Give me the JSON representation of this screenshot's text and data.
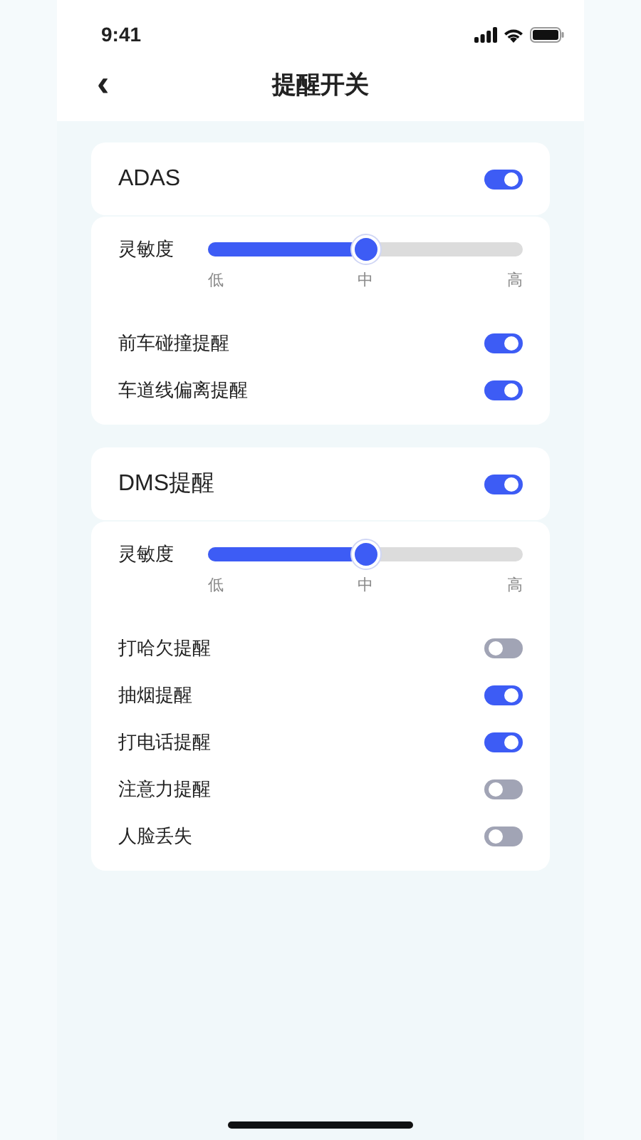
{
  "status_bar": {
    "time": "9:41"
  },
  "header": {
    "back": "‹",
    "title": "提醒开关"
  },
  "sections": [
    {
      "title": "ADAS",
      "on": true,
      "sensitivity": {
        "label": "灵敏度",
        "level": 0.5,
        "ticks": [
          "低",
          "中",
          "高"
        ]
      },
      "items": [
        {
          "label": "前车碰撞提醒",
          "on": true
        },
        {
          "label": "车道线偏离提醒",
          "on": true
        }
      ]
    },
    {
      "title": "DMS提醒",
      "on": true,
      "sensitivity": {
        "label": "灵敏度",
        "level": 0.5,
        "ticks": [
          "低",
          "中",
          "高"
        ]
      },
      "items": [
        {
          "label": "打哈欠提醒",
          "on": false
        },
        {
          "label": "抽烟提醒",
          "on": true
        },
        {
          "label": "打电话提醒",
          "on": true
        },
        {
          "label": "注意力提醒",
          "on": false
        },
        {
          "label": "人脸丢失",
          "on": false
        }
      ]
    }
  ]
}
